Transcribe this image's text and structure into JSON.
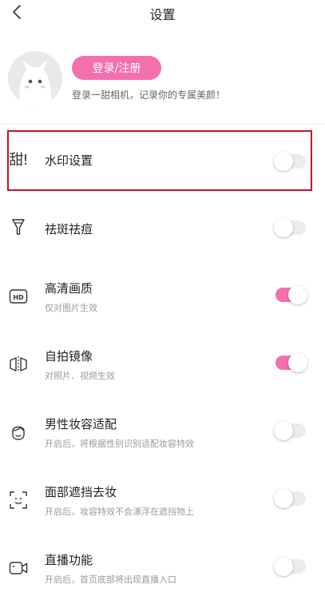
{
  "header": {
    "title": "设置"
  },
  "profile": {
    "login_label": "登录/注册",
    "tip": "登录一甜相机，记录你的专属美颜！"
  },
  "settings": [
    {
      "key": "watermark",
      "icon": "sweet-logo-icon",
      "icon_text": "甜!",
      "label": "水印设置",
      "sub": "",
      "enabled": false,
      "highlighted": true
    },
    {
      "key": "blemish",
      "icon": "concealer-icon",
      "label": "祛斑祛痘",
      "sub": "",
      "enabled": false
    },
    {
      "key": "hd",
      "icon": "hd-icon",
      "icon_text": "HD",
      "label": "高清画质",
      "sub": "仅对图片生效",
      "enabled": true
    },
    {
      "key": "mirror",
      "icon": "mirror-icon",
      "label": "自拍镜像",
      "sub": "对照片、视频生效",
      "enabled": true
    },
    {
      "key": "male_makeup",
      "icon": "male-face-icon",
      "label": "男性妆容适配",
      "sub": "开启后，将根据性别识别适配妆容特效",
      "enabled": false
    },
    {
      "key": "occlusion",
      "icon": "face-scan-icon",
      "label": "面部遮挡去妆",
      "sub": "开启后，妆容特效不会漂浮在遮挡物上",
      "enabled": false
    },
    {
      "key": "live",
      "icon": "video-camera-icon",
      "label": "直播功能",
      "sub": "开启后，首页底部将出现直播入口",
      "enabled": false
    }
  ],
  "colors": {
    "accent": "#f46fae",
    "highlight_border": "#c8102e"
  }
}
